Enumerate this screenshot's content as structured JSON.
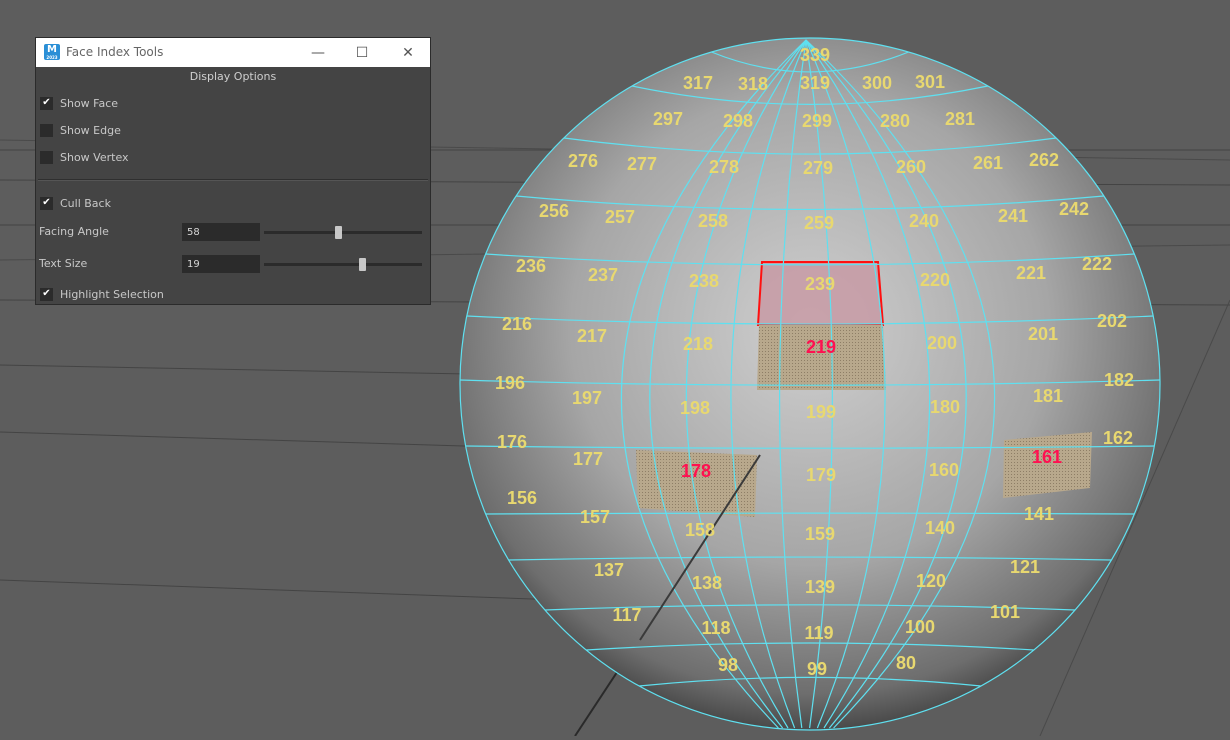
{
  "window": {
    "title": "Face Index Tools",
    "icon_letter": "M",
    "icon_sub": "2023",
    "minimize_glyph": "—",
    "maximize_glyph": "☐",
    "close_glyph": "✕"
  },
  "display_options": {
    "header": "Display Options",
    "show_face": {
      "label": "Show Face",
      "checked": true
    },
    "show_edge": {
      "label": "Show Edge",
      "checked": false
    },
    "show_vertex": {
      "label": "Show Vertex",
      "checked": false
    },
    "cull_back": {
      "label": "Cull Back",
      "checked": true
    },
    "facing_angle": {
      "label": "Facing Angle",
      "value": "58",
      "slider_fraction": 0.47
    },
    "text_size": {
      "label": "Text Size",
      "value": "19",
      "slider_fraction": 0.62
    },
    "highlight_selection": {
      "label": "Highlight Selection",
      "checked": true
    }
  },
  "check_glyph": "✔",
  "colors": {
    "viewport_bg": "#5d5d5d",
    "wireframe": "#5fe0f0",
    "face_label": "#e8d870",
    "selected_label": "#ff1050",
    "selection_outline": "#ff1010"
  },
  "face_labels": [
    {
      "id": "339",
      "selected": false
    },
    {
      "id": "317",
      "selected": false
    },
    {
      "id": "318",
      "selected": false
    },
    {
      "id": "319",
      "selected": false
    },
    {
      "id": "300",
      "selected": false
    },
    {
      "id": "301",
      "selected": false
    },
    {
      "id": "297",
      "selected": false
    },
    {
      "id": "298",
      "selected": false
    },
    {
      "id": "299",
      "selected": false
    },
    {
      "id": "280",
      "selected": false
    },
    {
      "id": "281",
      "selected": false
    },
    {
      "id": "276",
      "selected": false
    },
    {
      "id": "277",
      "selected": false
    },
    {
      "id": "278",
      "selected": false
    },
    {
      "id": "279",
      "selected": false
    },
    {
      "id": "260",
      "selected": false
    },
    {
      "id": "261",
      "selected": false
    },
    {
      "id": "262",
      "selected": false
    },
    {
      "id": "256",
      "selected": false
    },
    {
      "id": "257",
      "selected": false
    },
    {
      "id": "258",
      "selected": false
    },
    {
      "id": "259",
      "selected": false
    },
    {
      "id": "240",
      "selected": false
    },
    {
      "id": "241",
      "selected": false
    },
    {
      "id": "242",
      "selected": false
    },
    {
      "id": "236",
      "selected": false
    },
    {
      "id": "237",
      "selected": false
    },
    {
      "id": "238",
      "selected": false
    },
    {
      "id": "239",
      "selected": false
    },
    {
      "id": "220",
      "selected": false
    },
    {
      "id": "221",
      "selected": false
    },
    {
      "id": "222",
      "selected": false
    },
    {
      "id": "216",
      "selected": false
    },
    {
      "id": "217",
      "selected": false
    },
    {
      "id": "218",
      "selected": false
    },
    {
      "id": "219",
      "selected": true
    },
    {
      "id": "200",
      "selected": false
    },
    {
      "id": "201",
      "selected": false
    },
    {
      "id": "202",
      "selected": false
    },
    {
      "id": "196",
      "selected": false
    },
    {
      "id": "197",
      "selected": false
    },
    {
      "id": "198",
      "selected": false
    },
    {
      "id": "199",
      "selected": false
    },
    {
      "id": "180",
      "selected": false
    },
    {
      "id": "181",
      "selected": false
    },
    {
      "id": "182",
      "selected": false
    },
    {
      "id": "176",
      "selected": false
    },
    {
      "id": "177",
      "selected": false
    },
    {
      "id": "178",
      "selected": true
    },
    {
      "id": "179",
      "selected": false
    },
    {
      "id": "160",
      "selected": false
    },
    {
      "id": "161",
      "selected": true
    },
    {
      "id": "162",
      "selected": false
    },
    {
      "id": "156",
      "selected": false
    },
    {
      "id": "157",
      "selected": false
    },
    {
      "id": "158",
      "selected": false
    },
    {
      "id": "159",
      "selected": false
    },
    {
      "id": "140",
      "selected": false
    },
    {
      "id": "141",
      "selected": false
    },
    {
      "id": "137",
      "selected": false
    },
    {
      "id": "138",
      "selected": false
    },
    {
      "id": "139",
      "selected": false
    },
    {
      "id": "120",
      "selected": false
    },
    {
      "id": "121",
      "selected": false
    },
    {
      "id": "117",
      "selected": false
    },
    {
      "id": "118",
      "selected": false
    },
    {
      "id": "119",
      "selected": false
    },
    {
      "id": "100",
      "selected": false
    },
    {
      "id": "101",
      "selected": false
    },
    {
      "id": "98",
      "selected": false
    },
    {
      "id": "99",
      "selected": false
    },
    {
      "id": "80",
      "selected": false
    }
  ]
}
